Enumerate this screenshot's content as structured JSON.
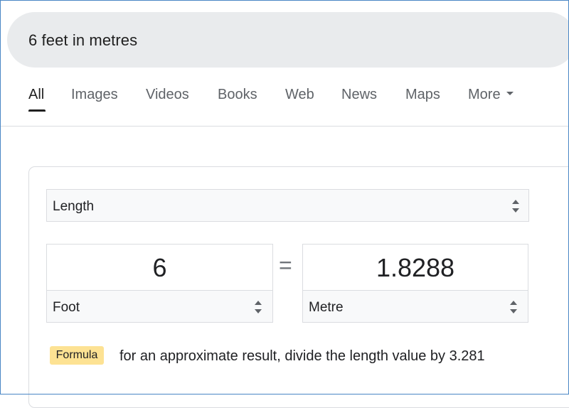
{
  "search": {
    "query": "6 feet in metres"
  },
  "tabs": [
    {
      "label": "All",
      "active": true
    },
    {
      "label": "Images"
    },
    {
      "label": "Videos"
    },
    {
      "label": "Books"
    },
    {
      "label": "Web"
    },
    {
      "label": "News"
    },
    {
      "label": "Maps"
    },
    {
      "label": "More"
    }
  ],
  "converter": {
    "category": "Length",
    "from": {
      "value": "6",
      "unit": "Foot"
    },
    "equals": "=",
    "to": {
      "value": "1.8288",
      "unit": "Metre"
    },
    "formula_label": "Formula",
    "formula_text": "for an approximate result, divide the length value by 3.281"
  },
  "colors": {
    "search_bg": "#e9ebed",
    "formula_badge": "#fde293",
    "frame_border": "#4a87c5"
  }
}
